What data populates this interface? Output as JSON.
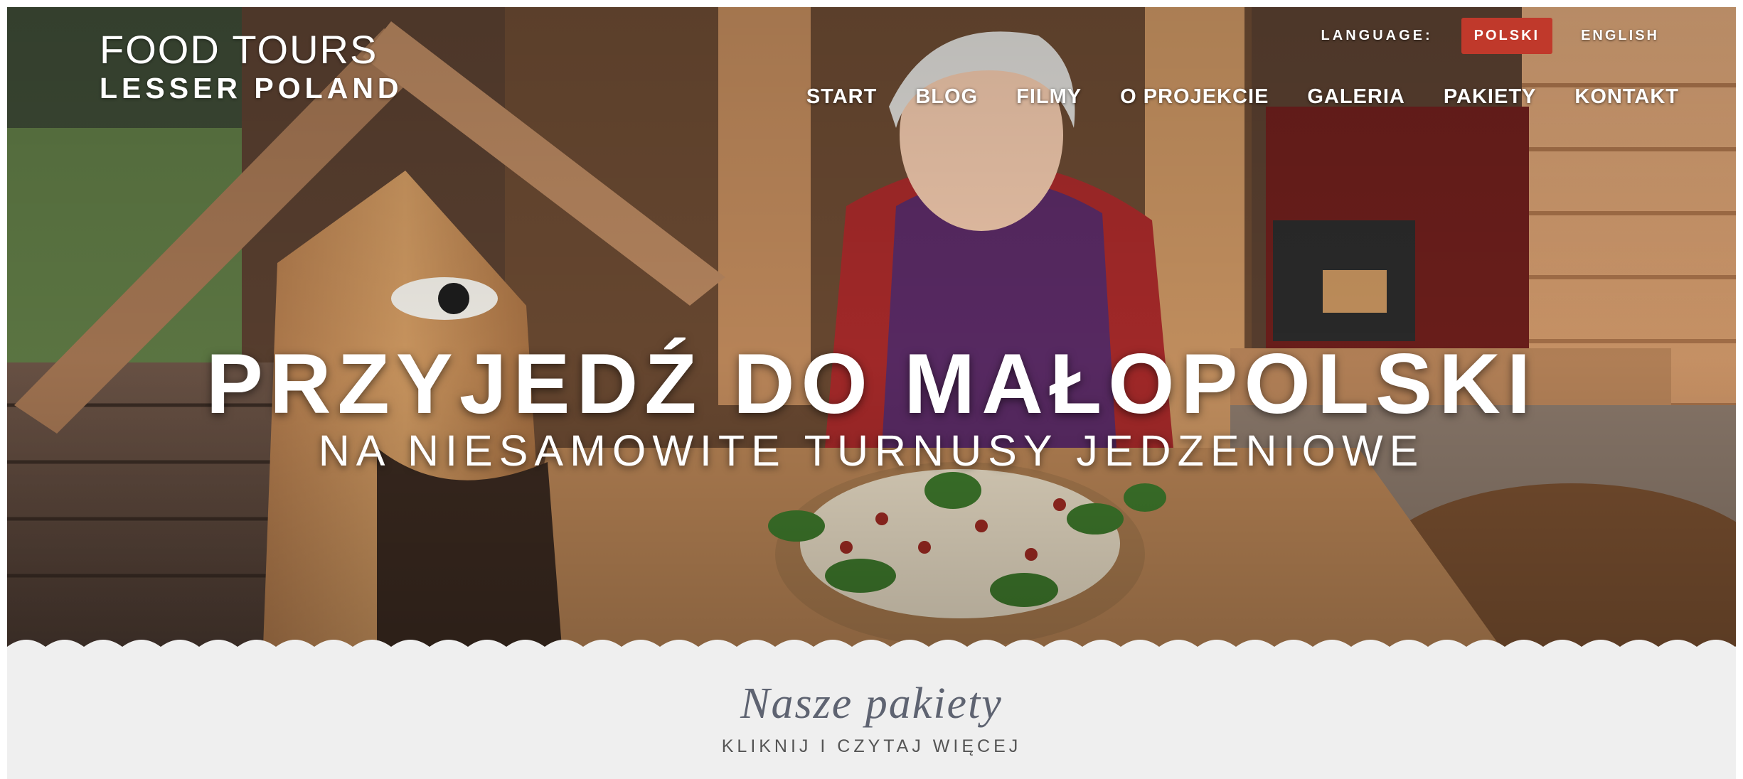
{
  "header": {
    "logo": {
      "line1": "FOOD TOURS",
      "line2": "LESSER POLAND"
    },
    "language": {
      "label": "LANGUAGE:",
      "options": [
        "POLSKI",
        "ENGLISH"
      ],
      "selected": "POLSKI",
      "active_color": "#c0392b"
    },
    "nav": [
      "START",
      "BLOG",
      "FILMY",
      "O PROJEKCIE",
      "GALERIA",
      "PAKIETY",
      "KONTAKT"
    ]
  },
  "hero": {
    "headline": "PRZYJEDŹ DO MAŁOPOLSKI",
    "subheadline": "NA NIESAMOWITE TURNUSY JEDZENIOWE"
  },
  "section": {
    "title": "Nasze pakiety",
    "subtitle": "KLIKNIJ I CZYTAJ WIĘCEJ"
  }
}
